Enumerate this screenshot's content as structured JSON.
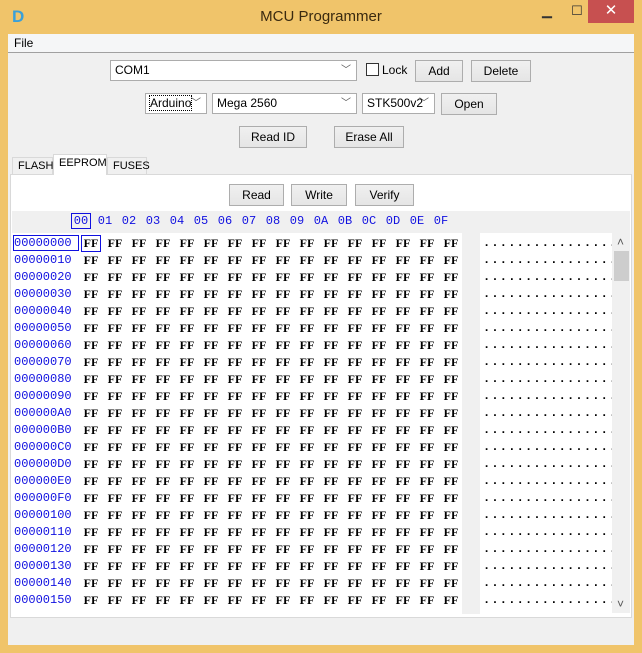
{
  "window": {
    "title": "MCU Programmer",
    "icon": "D",
    "minimize": "▁",
    "maximize": "☐",
    "close": "✕"
  },
  "menu": {
    "file": "File"
  },
  "port": {
    "value": "COM1",
    "lock_label": "Lock",
    "lock_checked": false,
    "add": "Add",
    "delete": "Delete"
  },
  "board": {
    "platform": "Arduino",
    "model": "Mega 2560",
    "protocol": "STK500v2",
    "open": "Open"
  },
  "actions": {
    "read_id": "Read ID",
    "erase_all": "Erase All"
  },
  "tabs": [
    {
      "label": "FLASH"
    },
    {
      "label": "EEPROM",
      "selected": true
    },
    {
      "label": "FUSES"
    }
  ],
  "eeprom": {
    "read": "Read",
    "write": "Write",
    "verify": "Verify"
  },
  "hex": {
    "columns": [
      "00",
      "01",
      "02",
      "03",
      "04",
      "05",
      "06",
      "07",
      "08",
      "09",
      "0A",
      "0B",
      "0C",
      "0D",
      "0E",
      "0F"
    ],
    "rows": [
      {
        "address": "00000000",
        "bytes": "FF FF FF FF FF FF FF FF FF FF FF FF FF FF FF FF",
        "ascii": "................"
      },
      {
        "address": "00000010",
        "bytes": "FF FF FF FF FF FF FF FF FF FF FF FF FF FF FF FF",
        "ascii": "................"
      },
      {
        "address": "00000020",
        "bytes": "FF FF FF FF FF FF FF FF FF FF FF FF FF FF FF FF",
        "ascii": "................"
      },
      {
        "address": "00000030",
        "bytes": "FF FF FF FF FF FF FF FF FF FF FF FF FF FF FF FF",
        "ascii": "................"
      },
      {
        "address": "00000040",
        "bytes": "FF FF FF FF FF FF FF FF FF FF FF FF FF FF FF FF",
        "ascii": "................"
      },
      {
        "address": "00000050",
        "bytes": "FF FF FF FF FF FF FF FF FF FF FF FF FF FF FF FF",
        "ascii": "................"
      },
      {
        "address": "00000060",
        "bytes": "FF FF FF FF FF FF FF FF FF FF FF FF FF FF FF FF",
        "ascii": "................"
      },
      {
        "address": "00000070",
        "bytes": "FF FF FF FF FF FF FF FF FF FF FF FF FF FF FF FF",
        "ascii": "................"
      },
      {
        "address": "00000080",
        "bytes": "FF FF FF FF FF FF FF FF FF FF FF FF FF FF FF FF",
        "ascii": "................"
      },
      {
        "address": "00000090",
        "bytes": "FF FF FF FF FF FF FF FF FF FF FF FF FF FF FF FF",
        "ascii": "................"
      },
      {
        "address": "000000A0",
        "bytes": "FF FF FF FF FF FF FF FF FF FF FF FF FF FF FF FF",
        "ascii": "................"
      },
      {
        "address": "000000B0",
        "bytes": "FF FF FF FF FF FF FF FF FF FF FF FF FF FF FF FF",
        "ascii": "................"
      },
      {
        "address": "000000C0",
        "bytes": "FF FF FF FF FF FF FF FF FF FF FF FF FF FF FF FF",
        "ascii": "................"
      },
      {
        "address": "000000D0",
        "bytes": "FF FF FF FF FF FF FF FF FF FF FF FF FF FF FF FF",
        "ascii": "................"
      },
      {
        "address": "000000E0",
        "bytes": "FF FF FF FF FF FF FF FF FF FF FF FF FF FF FF FF",
        "ascii": "................"
      },
      {
        "address": "000000F0",
        "bytes": "FF FF FF FF FF FF FF FF FF FF FF FF FF FF FF FF",
        "ascii": "................"
      },
      {
        "address": "00000100",
        "bytes": "FF FF FF FF FF FF FF FF FF FF FF FF FF FF FF FF",
        "ascii": "................"
      },
      {
        "address": "00000110",
        "bytes": "FF FF FF FF FF FF FF FF FF FF FF FF FF FF FF FF",
        "ascii": "................"
      },
      {
        "address": "00000120",
        "bytes": "FF FF FF FF FF FF FF FF FF FF FF FF FF FF FF FF",
        "ascii": "................"
      },
      {
        "address": "00000130",
        "bytes": "FF FF FF FF FF FF FF FF FF FF FF FF FF FF FF FF",
        "ascii": "................"
      },
      {
        "address": "00000140",
        "bytes": "FF FF FF FF FF FF FF FF FF FF FF FF FF FF FF FF",
        "ascii": "................"
      },
      {
        "address": "00000150",
        "bytes": "FF FF FF FF FF FF FF FF FF FF FF FF FF FF FF FF",
        "ascii": "................"
      }
    ]
  },
  "scrollbar": {
    "up": "˄",
    "down": "˅"
  },
  "colors": {
    "accent": "#1010e0",
    "frame": "#f0c46a",
    "close": "#c75050"
  }
}
